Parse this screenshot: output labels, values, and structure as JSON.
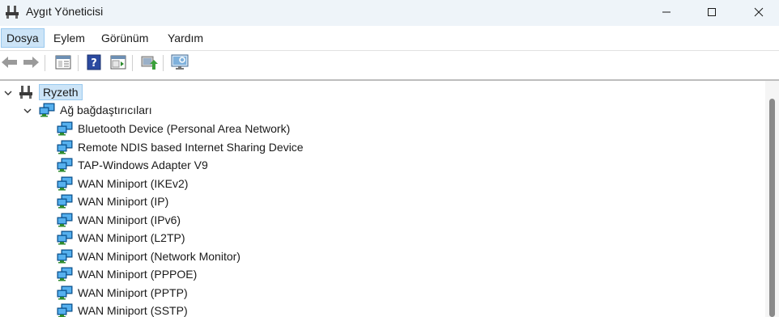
{
  "window": {
    "title": "Aygıt Yöneticisi"
  },
  "menu": [
    "Dosya",
    "Eylem",
    "Görünüm",
    "Yardım"
  ],
  "toolbar": [
    "back",
    "forward",
    "properties",
    "help",
    "run",
    "update-driver",
    "scan-hardware"
  ],
  "tree": {
    "root": "Ryzeth",
    "category": "Ağ bağdaştırıcıları",
    "devices": [
      "Bluetooth Device (Personal Area Network)",
      "Remote NDIS based Internet Sharing Device",
      "TAP-Windows Adapter V9",
      "WAN Miniport (IKEv2)",
      "WAN Miniport (IP)",
      "WAN Miniport (IPv6)",
      "WAN Miniport (L2TP)",
      "WAN Miniport (Network Monitor)",
      "WAN Miniport (PPPOE)",
      "WAN Miniport (PPTP)",
      "WAN Miniport (SSTP)"
    ]
  },
  "colors": {
    "selection": "#cce4f7",
    "titlebar": "#eef4f9",
    "accent": "#0078d4"
  }
}
